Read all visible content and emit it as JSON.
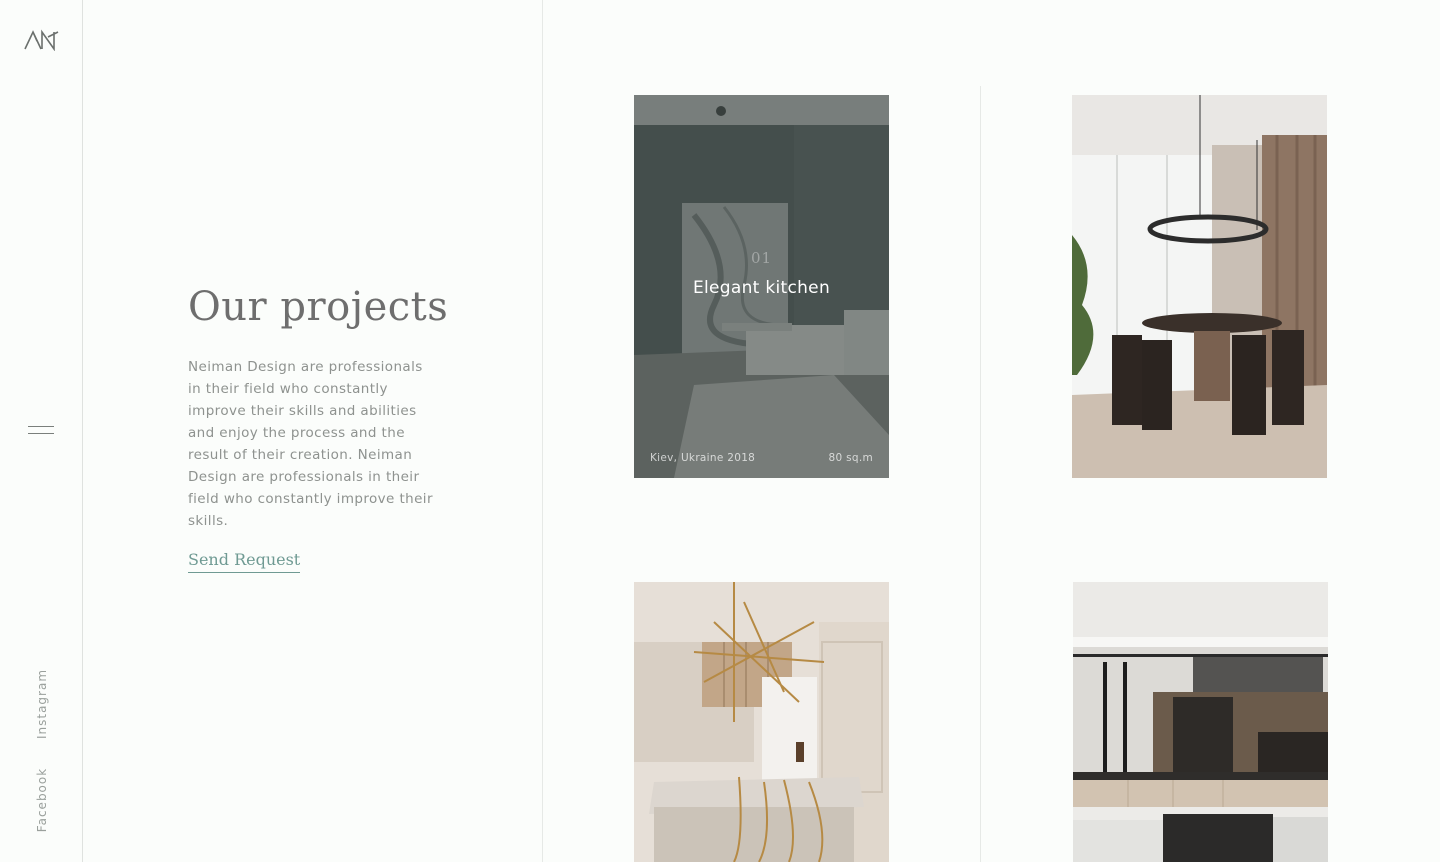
{
  "sidebar": {
    "logo_icon": "monogram-logo",
    "menu_icon": "hamburger-menu-icon",
    "social": [
      {
        "label": "Instagram"
      },
      {
        "label": "Facebook"
      }
    ]
  },
  "intro": {
    "title": "Our projects",
    "description": "Neiman Design are professionals in their field who constantly improve their skills and abilities and enjoy the process and the result of their creation. Neiman Design are professionals in their field who constantly improve their skills.",
    "cta_label": "Send Request"
  },
  "projects": [
    {
      "number": "01",
      "title": "Elegant kitchen",
      "location": "Kiev, Ukraine 2018",
      "area": "80 sq.m",
      "scene": "living-room-photo",
      "hovered": true
    },
    {
      "scene": "dining-room-photo"
    },
    {
      "scene": "kitchen-island-photo"
    },
    {
      "scene": "modern-kitchen-photo"
    }
  ],
  "colors": {
    "background": "#fbfdfb",
    "accent": "#6f9a93",
    "text": "#6e6e6e",
    "muted": "#8e928f"
  }
}
